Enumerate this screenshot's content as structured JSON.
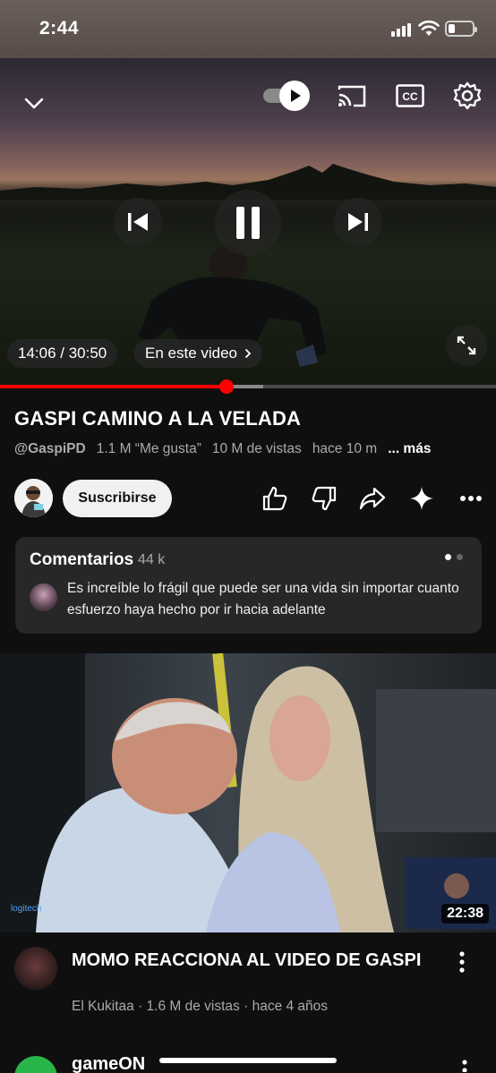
{
  "status_bar": {
    "time": "2:44"
  },
  "player": {
    "current_time": "14:06 / 30:50",
    "chapter_label": "En este video",
    "progress_played": 0.457,
    "progress_buffered": 0.53,
    "icons": [
      "chevron-down-icon",
      "autoplay-toggle-icon",
      "cast-icon",
      "cc-icon",
      "settings-icon",
      "previous-icon",
      "pause-icon",
      "next-icon",
      "fullscreen-icon"
    ]
  },
  "video": {
    "title": "GASPI CAMINO A LA VELADA",
    "channel": "@GaspiPD",
    "likes": "1.1 M “Me gusta”",
    "views": "10 M de vistas",
    "age": "hace 10 m",
    "more": "... más"
  },
  "channel_row": {
    "subscribe_label": "Suscribirse",
    "actions": [
      "like-icon",
      "dislike-icon",
      "share-icon",
      "sparkle-icon",
      "more-icon"
    ]
  },
  "comments": {
    "title": "Comentarios",
    "count": "44 k",
    "top_comment": "Es increíble lo frágil que puede ser una vida sin importar cuanto esfuerzo haya hecho por ir hacia adelante"
  },
  "recommendation": {
    "duration": "22:38",
    "title": "MOMO REACCIONA AL VIDEO DE GASPI",
    "meta": "El Kukitaa · 1.6 M de vistas · hace 4 años"
  },
  "next_item": {
    "title": "gameON"
  },
  "colors": {
    "accent": "#ff0000",
    "background": "#0f0f0f",
    "card": "#272727",
    "muted": "#aaaaaa"
  }
}
